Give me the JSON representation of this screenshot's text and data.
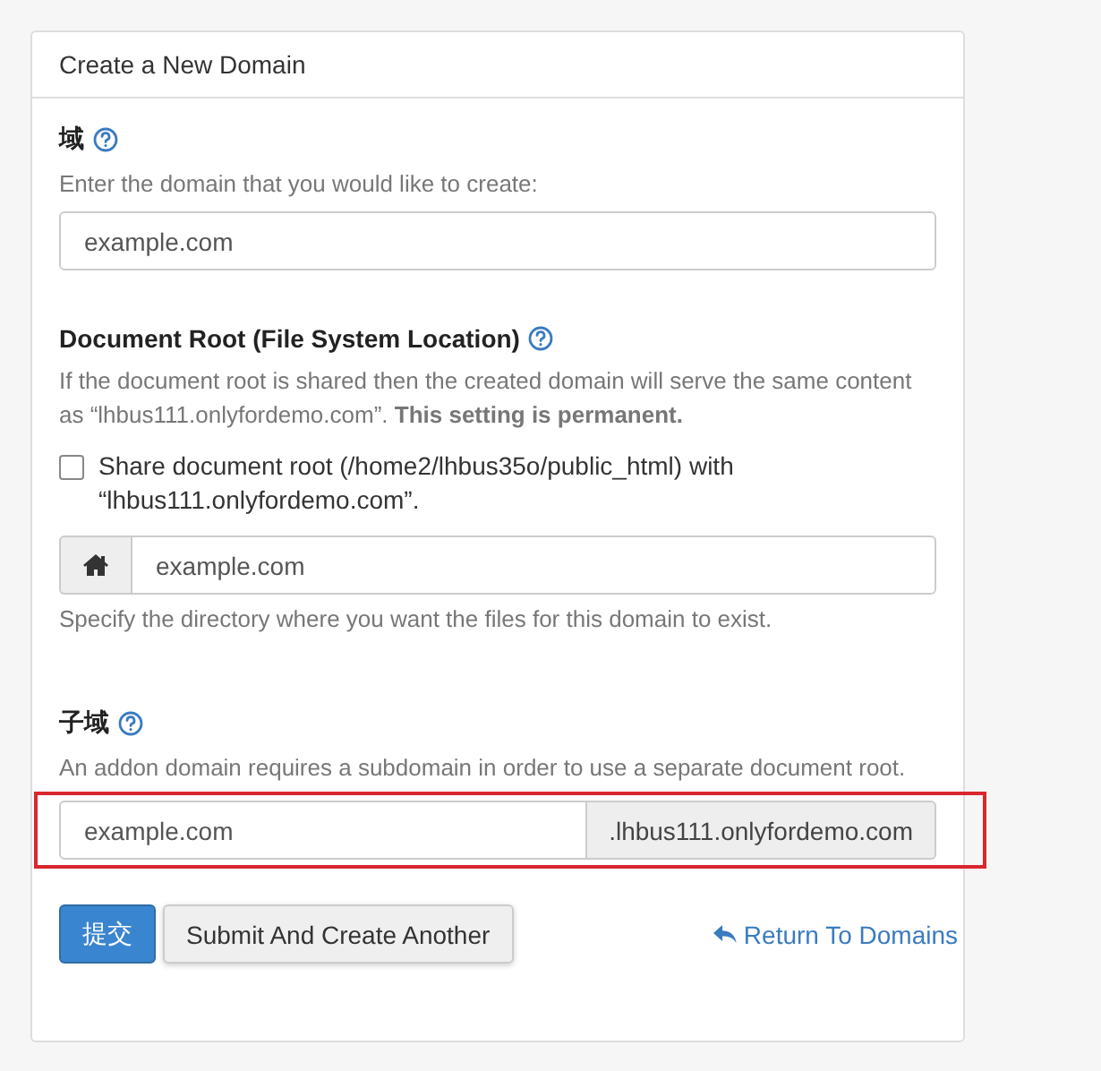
{
  "panel": {
    "title": "Create a New Domain"
  },
  "domain": {
    "label": "域",
    "help": "Enter the domain that you would like to create:",
    "placeholder": "example.com"
  },
  "document_root": {
    "label": "Document Root (File System Location)",
    "help": "If the document root is shared then the created domain will serve the same content as “lhbus111.onlyfordemo.com”. **This setting is permanent.**",
    "share_checkbox": {
      "label": "Share document root (/home2/lhbus35o/public_html) with “lhbus111.onlyfordemo.com”.",
      "checked": false
    },
    "placeholder": "example.com",
    "hint": "Specify the directory where you want the files for this domain to exist."
  },
  "subdomain": {
    "label": "子域",
    "help": "An addon domain requires a subdomain in order to use a separate document root.",
    "placeholder": "example.com",
    "suffix": ".lhbus111.onlyfordemo.com",
    "highlighted": true
  },
  "buttons": [
    {
      "label": "提交",
      "kind": "primary"
    },
    {
      "label": "Submit And Create Another",
      "kind": "default"
    }
  ],
  "return_link": {
    "label": "Return To Domains"
  }
}
